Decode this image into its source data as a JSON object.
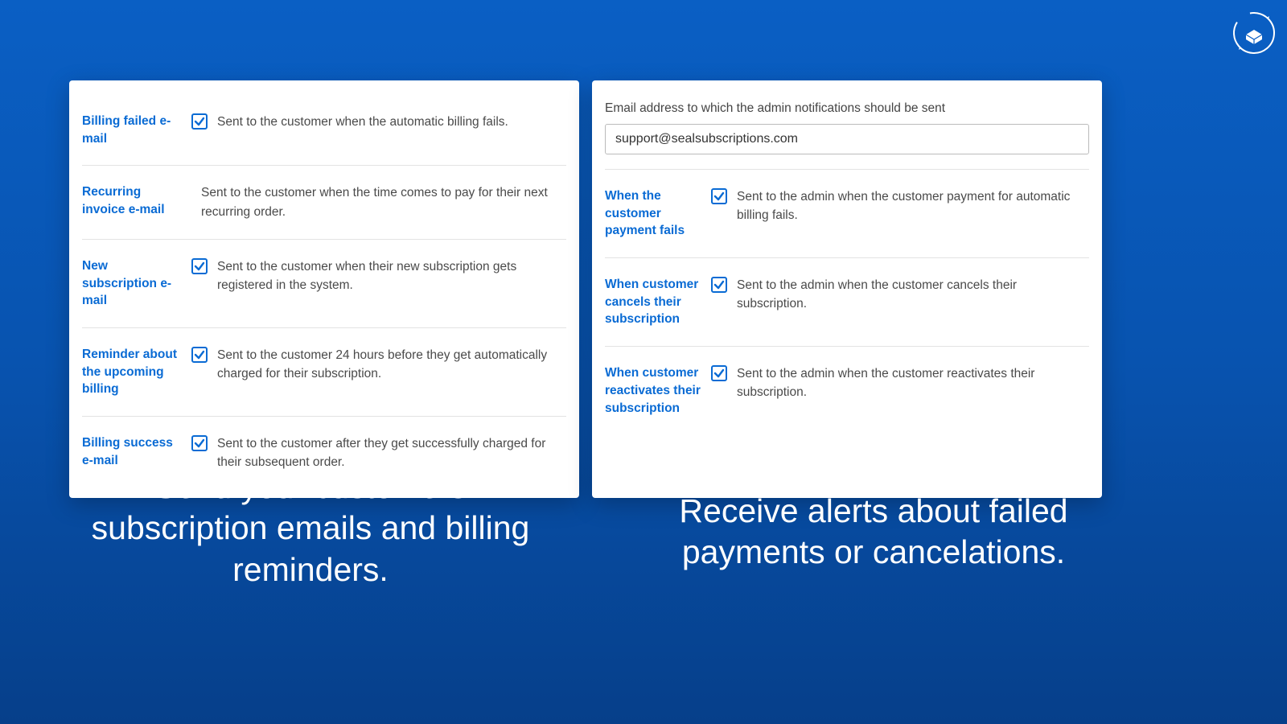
{
  "logo": {
    "name": "seal-subscriptions-logo"
  },
  "left_panel": {
    "rows": [
      {
        "label": "Billing failed e-mail",
        "checked": true,
        "desc": "Sent to the customer when the automatic billing fails."
      },
      {
        "label": "Recurring invoice e-mail",
        "checked": false,
        "desc": "Sent to the customer when the time comes to pay for their next recurring order."
      },
      {
        "label": "New subscription e-mail",
        "checked": true,
        "desc": "Sent to the customer when their new subscription gets registered in the system."
      },
      {
        "label": "Reminder about the upcoming billing",
        "checked": true,
        "desc": "Sent to the customer 24 hours before they get automatically charged for their subscription."
      },
      {
        "label": "Billing success e-mail",
        "checked": true,
        "desc": "Sent to the customer after they get successfully charged for their subsequent order."
      }
    ]
  },
  "right_panel": {
    "email_label": "Email address to which the admin notifications should be sent",
    "email_value": "support@sealsubscriptions.com",
    "rows": [
      {
        "label": "When the customer payment fails",
        "checked": true,
        "desc": "Sent to the admin when the customer payment for automatic billing fails."
      },
      {
        "label": "When customer cancels their subscription",
        "checked": true,
        "desc": "Sent to the admin when the customer cancels their subscription."
      },
      {
        "label": "When customer reactivates their subscription",
        "checked": true,
        "desc": "Sent to the admin when the customer reactivates their subscription."
      }
    ]
  },
  "captions": {
    "left": "Send your customers subscription emails and billing reminders.",
    "right": "Receive alerts about failed payments or cancelations."
  }
}
